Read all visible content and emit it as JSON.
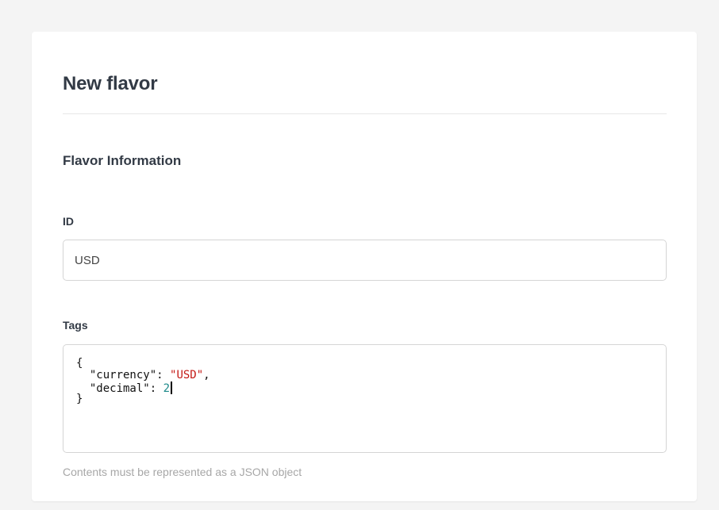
{
  "form": {
    "title": "New flavor",
    "section_title": "Flavor Information",
    "id_field": {
      "label": "ID",
      "value": "USD"
    },
    "tags_field": {
      "label": "Tags",
      "lines": [
        {
          "open": "{"
        },
        {
          "indent": "  ",
          "key": "\"currency\"",
          "sep": ": ",
          "value": "\"USD\"",
          "trail": ","
        },
        {
          "indent": "  ",
          "key": "\"decimal\"",
          "sep": ": ",
          "value": "2",
          "trail": ""
        },
        {
          "close": "}"
        }
      ],
      "help_text": "Contents must be represented as a JSON object"
    }
  },
  "colors": {
    "page_bg": "#f4f4f4",
    "card_bg": "#ffffff",
    "string_value": "#c41a16",
    "number_value": "#1c8a8a",
    "help_text": "#a7a7a7"
  }
}
